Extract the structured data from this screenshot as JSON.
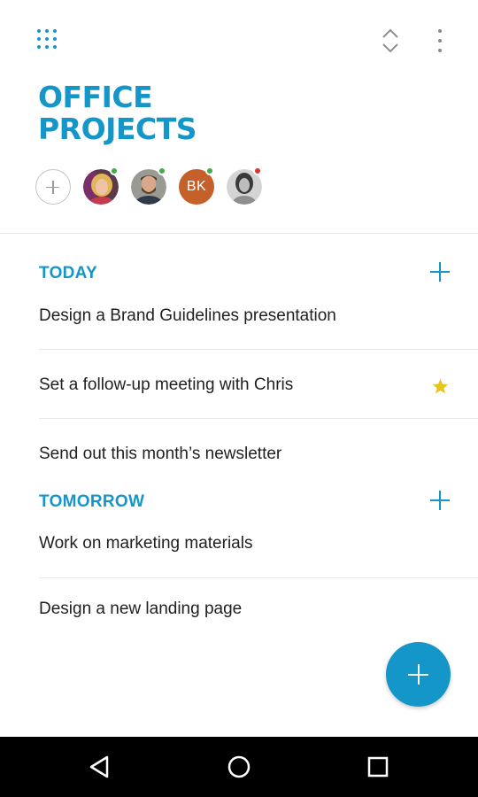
{
  "header": {
    "menu_icon": "apps-grid-icon",
    "sort_icon": "expand-collapse-icon",
    "more_icon": "more-vertical-icon"
  },
  "project": {
    "title_line1": "OFFICE",
    "title_line2": "PROJECTS"
  },
  "members": {
    "add_icon": "add-member-icon",
    "list": [
      {
        "type": "photo",
        "status": "online",
        "status_color": "#3fae49"
      },
      {
        "type": "photo",
        "status": "online",
        "status_color": "#3fae49"
      },
      {
        "type": "initials",
        "initials": "BK",
        "status": "online",
        "status_color": "#3fae49",
        "color": "#c6602a"
      },
      {
        "type": "photo",
        "status": "busy",
        "status_color": "#e0352b"
      }
    ]
  },
  "sections": [
    {
      "label": "TODAY",
      "tasks": [
        {
          "text": "Design a Brand Guidelines presentation",
          "starred": false
        },
        {
          "text": "Set a follow-up meeting with Chris",
          "starred": true
        },
        {
          "text": "Send out this month’s newsletter",
          "starred": false
        }
      ]
    },
    {
      "label": "TOMORROW",
      "tasks": [
        {
          "text": "Work on marketing materials",
          "starred": false
        },
        {
          "text": "Design a new landing page",
          "starred": false
        }
      ]
    }
  ],
  "fab": {
    "icon": "add-task-icon"
  },
  "navigation": {
    "back_icon": "back-triangle-icon",
    "home_icon": "home-circle-icon",
    "recents_icon": "recents-square-icon"
  },
  "colors": {
    "accent": "#1596c9",
    "star": "#e8c51a",
    "navbar": "#000000"
  }
}
